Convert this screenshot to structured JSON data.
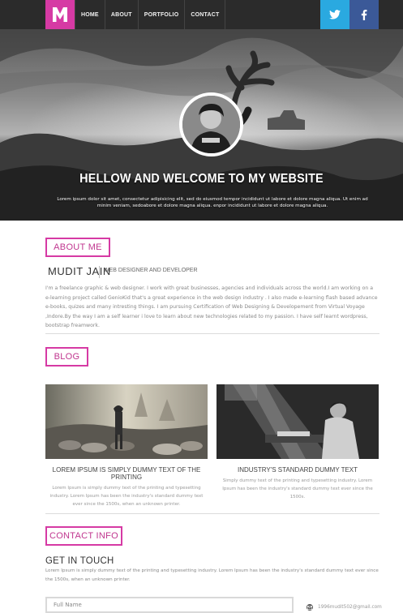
{
  "header": {
    "logo_letter": "M",
    "logo_color": "#d63aa4",
    "nav": [
      {
        "label": "HOME"
      },
      {
        "label": "ABOUT"
      },
      {
        "label": "PORTFOLIO"
      },
      {
        "label": "CONTACT"
      }
    ],
    "social": [
      {
        "icon": "twitter-icon",
        "color": "#2aa9e0"
      },
      {
        "icon": "facebook-icon",
        "color": "#3b5998"
      }
    ]
  },
  "hero": {
    "title": "HELLOW AND WELCOME TO MY WEBSITE",
    "text": "Lorem ipsum dolor sit amet, consectetur adipisicing elit, sed do eiusmod tempor incididunt ut labore et dolore magna aliqua. Ut enim ad minim veniam, sedoabore et dolore magna aliqua. enpor incididunt ut labore et dolore magna aliqua."
  },
  "about": {
    "tag": "ABOUT ME",
    "name": "MUDIT JAIN",
    "role": "WEB DESIGNER AND DEVELOPER",
    "text": "I'm a freelance graphic & web designer. I work with great businesses, agencies and individuals across the world.I am working on a e-learning project called GenioKid that's a great experience in the web design industry . I also made e-learning flash based advance e-books, quizes and many intresting things. I am pursuing Certification of Web Designing & Developement from Virtual Voyage ,Indore.By the way I am a self learner i love to learn about new technologies related to my passion. I have self learnt wordpress, bootstrap freamwork."
  },
  "blog": {
    "tag": "BLOG",
    "posts": [
      {
        "title": "LOREM IPSUM IS SIMPLY DUMMY TEXT OF THE PRINTING",
        "text": "Lorem Ipsum is simply dummy text of the printing and typesetting industry. Lorem Ipsum has been the industry's standard dummy text ever since the 1500s, when an unknown printer."
      },
      {
        "title": "INDUSTRY'S STANDARD DUMMY TEXT",
        "text": "Simply dummy text of the printing and typesetting industry. Lorem Ipsum has been the industry's standard dummy text ever since the 1500s."
      }
    ]
  },
  "contact": {
    "tag": "CONTACT INFO",
    "heading": "GET IN TOUCH",
    "text": "Lorem Ipsum is simply dummy text of the printing and typesetting industry. Lorem Ipsum has been the industry's standard dummy text ever since the 1500s, when an unknown printer.",
    "name_placeholder": "Full Name",
    "email": "1996mudit502@gmail.com"
  }
}
